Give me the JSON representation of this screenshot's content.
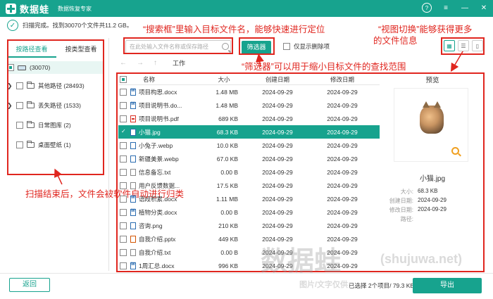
{
  "app": {
    "logo_text": "数据蛙",
    "subtitle": "数据恢复专家",
    "help_label": "?",
    "menu_label": "≡",
    "minimize_label": "—",
    "close_label": "✕"
  },
  "status": {
    "scan_text": "扫描完成。找到30070个文件共11.2 GB。"
  },
  "annotations": {
    "search": "“搜索框”里输入目标文件名，能够快速进行定位",
    "view_line1": "“视图切换”能够获得更多",
    "view_line2": "的文件信息",
    "filter": "“筛选器”可以用于缩小目标文件的查找范围",
    "classify": "扫描结束后，文件会被软件自动进行归类"
  },
  "tabs": {
    "by_path": "按路径查看",
    "by_type": "按类型查看"
  },
  "tree": {
    "root_count": "(30070)",
    "items": [
      {
        "label": "其他路径 (28493)"
      },
      {
        "label": "丢失路径 (1533)"
      },
      {
        "label": "日常图库 (2)"
      },
      {
        "label": "桌面壁纸 (1)"
      }
    ]
  },
  "toolbar": {
    "search_placeholder": "在此处输入文件名称或保存路径",
    "filter_label": "筛选器",
    "only_deleted_label": "仅显示删除项",
    "nav_back": "←",
    "nav_forward": "→",
    "nav_up": "↑",
    "path": "工作"
  },
  "table": {
    "headers": {
      "name": "名称",
      "size": "大小",
      "created": "创建日期",
      "modified": "修改日期"
    },
    "rows": [
      {
        "name": "项目构思.docx",
        "size": "1.48 MB",
        "created": "2024-09-29",
        "modified": "2024-09-29",
        "type": "word"
      },
      {
        "name": "项目说明书.do...",
        "size": "1.48 MB",
        "created": "2024-09-29",
        "modified": "2024-09-29",
        "type": "word"
      },
      {
        "name": "项目说明书.pdf",
        "size": "689 KB",
        "created": "2024-09-29",
        "modified": "2024-09-29",
        "type": "pdf"
      },
      {
        "name": "小猫.jpg",
        "size": "68.3 KB",
        "created": "2024-09-29",
        "modified": "2024-09-29",
        "type": "img"
      },
      {
        "name": "小兔子.webp",
        "size": "10.0 KB",
        "created": "2024-09-29",
        "modified": "2024-09-29",
        "type": "img"
      },
      {
        "name": "新疆美景.webp",
        "size": "67.0 KB",
        "created": "2024-09-29",
        "modified": "2024-09-29",
        "type": "img"
      },
      {
        "name": "信息备忘.txt",
        "size": "0.00 B",
        "created": "2024-09-29",
        "modified": "2024-09-29",
        "type": "txt"
      },
      {
        "name": "用户反馈数据...",
        "size": "17.5 KB",
        "created": "2024-09-29",
        "modified": "2024-09-29",
        "type": "txt"
      },
      {
        "name": "语段积累.docx",
        "size": "1.11 MB",
        "created": "2024-09-29",
        "modified": "2024-09-29",
        "type": "word"
      },
      {
        "name": "植物分类.docx",
        "size": "0.00 B",
        "created": "2024-09-29",
        "modified": "2024-09-29",
        "type": "word"
      },
      {
        "name": "咨询.png",
        "size": "210 KB",
        "created": "2024-09-29",
        "modified": "2024-09-29",
        "type": "img"
      },
      {
        "name": "自我介绍.pptx",
        "size": "449 KB",
        "created": "2024-09-29",
        "modified": "2024-09-29",
        "type": "ppt"
      },
      {
        "name": "自我介绍.txt",
        "size": "0.00 B",
        "created": "2024-09-29",
        "modified": "2024-09-29",
        "type": "txt"
      },
      {
        "name": "1周汇总.docx",
        "size": "996 KB",
        "created": "2024-09-29",
        "modified": "2024-09-29",
        "type": "word"
      }
    ]
  },
  "preview": {
    "title": "预览",
    "filename": "小猫.jpg",
    "size_label": "大小:",
    "size_value": "68.3 KB",
    "created_label": "创建日期:",
    "created_value": "2024-09-29",
    "modified_label": "修改日期:",
    "modified_value": "2024-09-29",
    "path_label": "路径:"
  },
  "footer": {
    "back_label": "返回",
    "selected_info": "已选择 2个项目/ 79.3 KB",
    "export_label": "导出"
  },
  "watermark": {
    "brand": "数据蛙",
    "domain": "(shujuwa.net)",
    "note": "图片/文字仅供"
  }
}
